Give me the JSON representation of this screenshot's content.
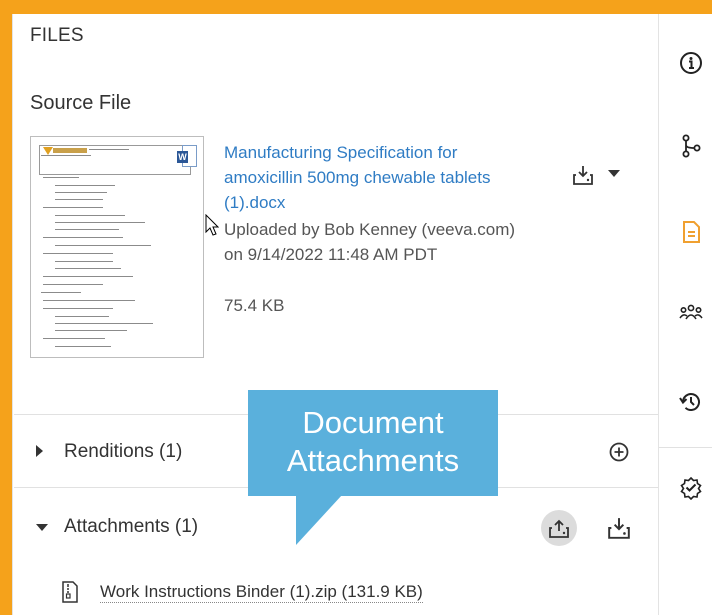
{
  "files_header": "FILES",
  "source_file": {
    "title": "Source File",
    "file_name": "Manufacturing Specification for amoxicillin 500mg chewable tablets (1).docx",
    "uploaded_by": "Uploaded by Bob Kenney (veeva.com) on 9/14/2022 11:48 AM PDT",
    "size": "75.4 KB",
    "thumbnail_logo": "Vault QualityDocs",
    "thumbnail_heading": "TABLE OF CONTENTS"
  },
  "renditions": {
    "label": "Renditions (1)",
    "expanded": false
  },
  "attachments": {
    "label": "Attachments (1)",
    "expanded": true,
    "items": [
      {
        "name": "Work Instructions Binder (1).zip (131.9 KB)",
        "icon": "zip-file-icon"
      }
    ]
  },
  "callout": {
    "line1": "Document",
    "line2": "Attachments"
  },
  "sidebar": {
    "items": [
      {
        "name": "info-icon",
        "active": false
      },
      {
        "name": "workflow-icon",
        "active": false
      },
      {
        "name": "document-icon",
        "active": true
      },
      {
        "name": "sharing-icon",
        "active": false
      },
      {
        "name": "history-icon",
        "active": false
      },
      {
        "name": "signature-icon",
        "active": false
      }
    ]
  },
  "colors": {
    "frame": "#f5a21b",
    "link": "#2f7cc4",
    "callout": "#5ab0dc",
    "active_icon": "#f0a030",
    "text": "#333333"
  }
}
